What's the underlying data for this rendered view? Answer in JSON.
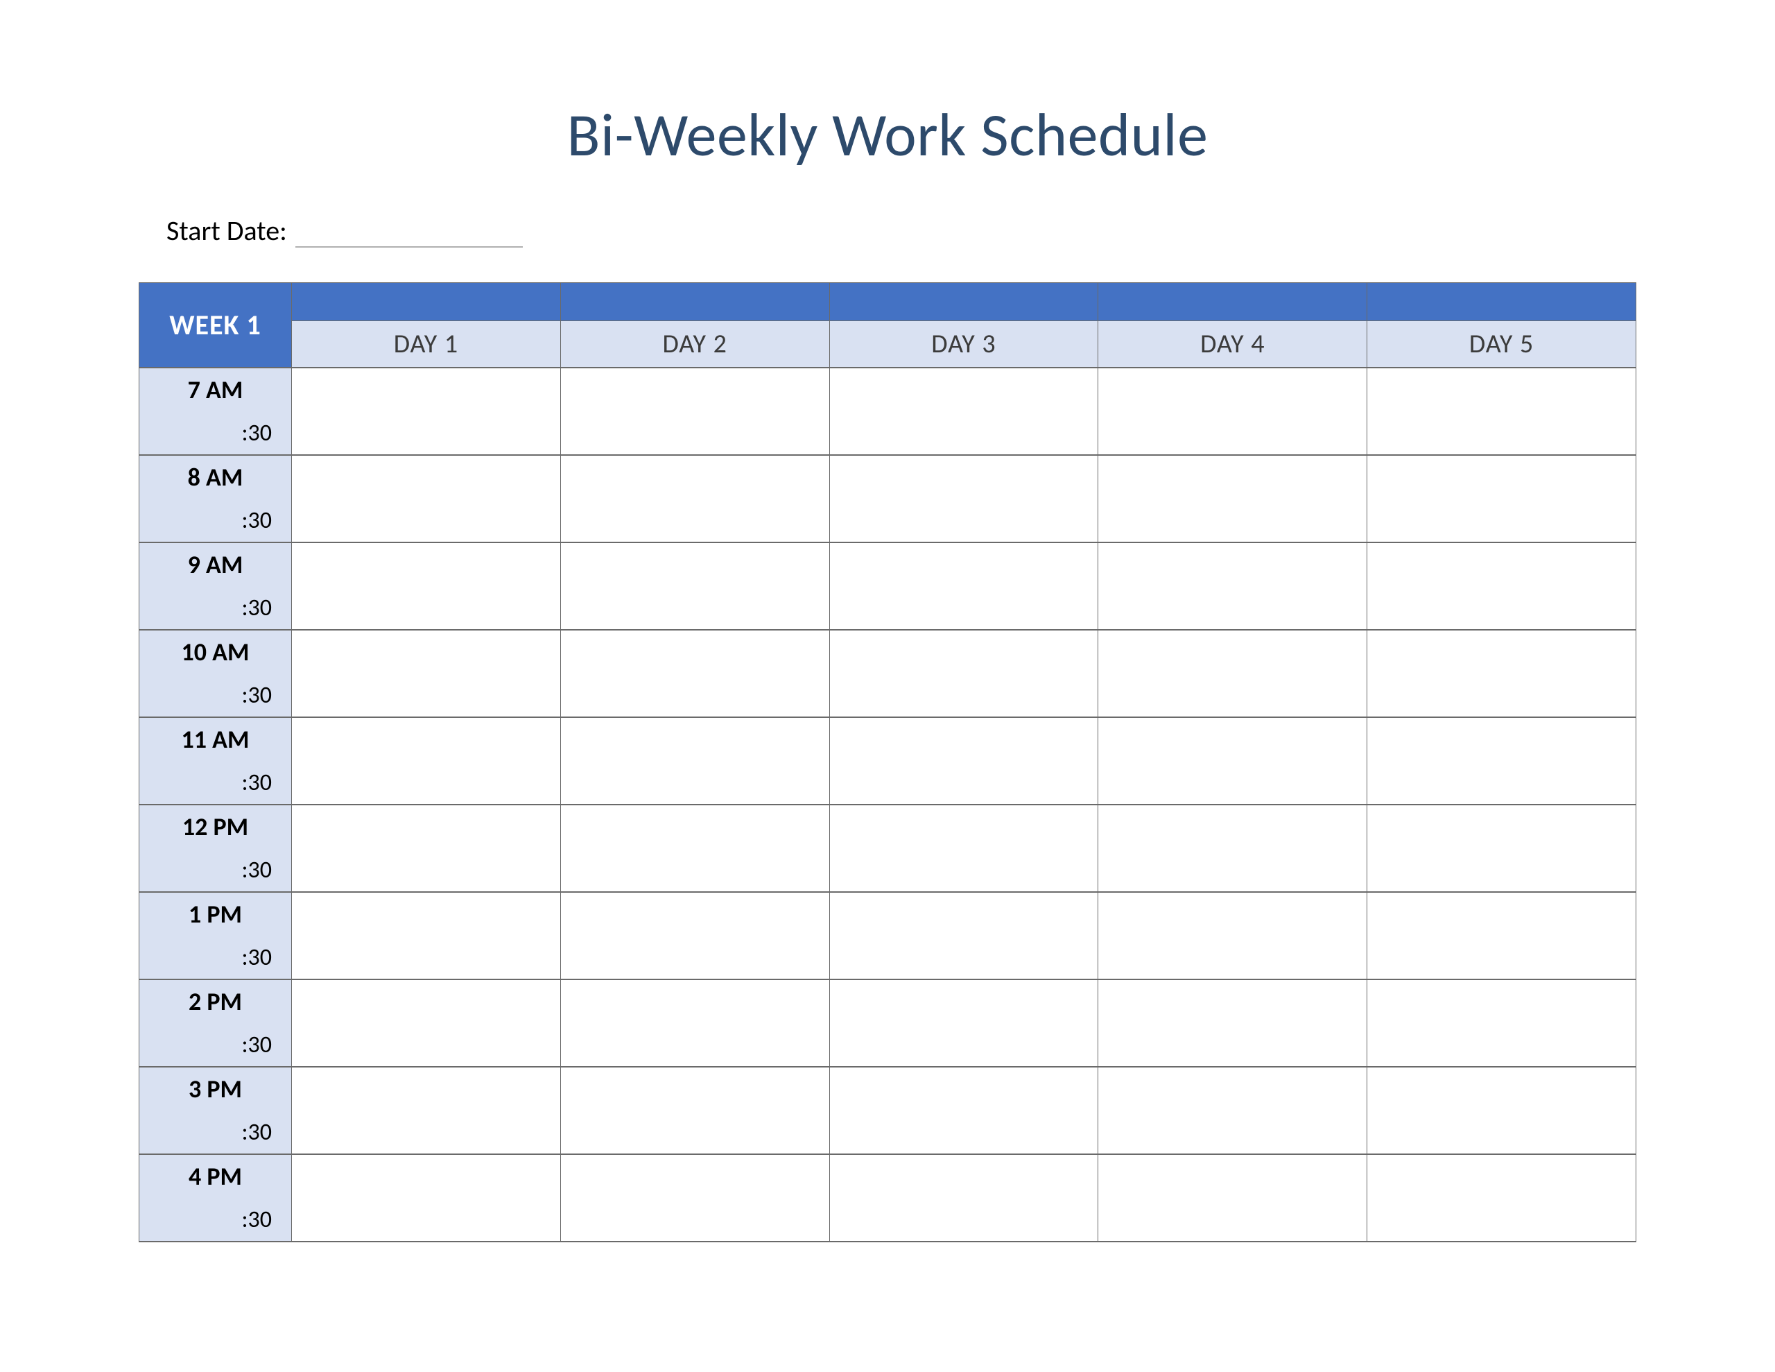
{
  "title": "Bi-Weekly Work Schedule",
  "start_date_label": "Start Date:",
  "start_date_value": "",
  "week_label": "WEEK 1",
  "days": [
    "DAY 1",
    "DAY 2",
    "DAY 3",
    "DAY 4",
    "DAY 5"
  ],
  "half_hour_label": ":30",
  "hours": [
    {
      "label": "7 AM"
    },
    {
      "label": "8 AM"
    },
    {
      "label": "9 AM"
    },
    {
      "label": "10 AM"
    },
    {
      "label": "11 AM"
    },
    {
      "label": "12 PM"
    },
    {
      "label": "1 PM"
    },
    {
      "label": "2 PM"
    },
    {
      "label": "3 PM"
    },
    {
      "label": "4 PM"
    }
  ],
  "colors": {
    "header_band": "#4472c4",
    "light_band": "#d9e1f2",
    "title_text": "#2d4a6b"
  }
}
